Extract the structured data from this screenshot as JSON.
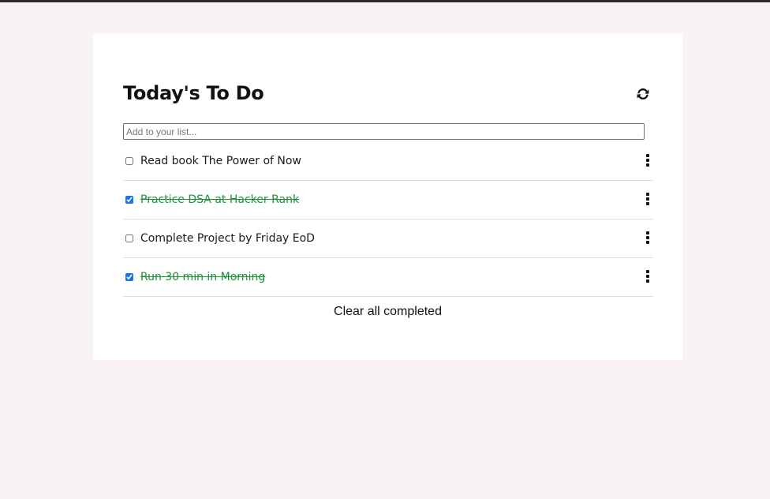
{
  "header": {
    "title": "Today's To Do",
    "refresh_icon": "refresh-icon"
  },
  "input": {
    "placeholder": "Add to your list...",
    "value": ""
  },
  "todos": [
    {
      "label": "Read book The Power of Now",
      "completed": false
    },
    {
      "label": "Practice DSA at Hacker Rank",
      "completed": true
    },
    {
      "label": "Complete Project by Friday EoD",
      "completed": false
    },
    {
      "label": "Run 30 min in Morning",
      "completed": true
    }
  ],
  "menu_icon": "more-vertical-icon",
  "footer": {
    "clear_label": "Clear all completed"
  },
  "colors": {
    "page_background": "#f9f3f3",
    "card_background": "#ffffff",
    "completed_text": "#1e8f3a",
    "checkbox_accent": "#1a73e8"
  }
}
